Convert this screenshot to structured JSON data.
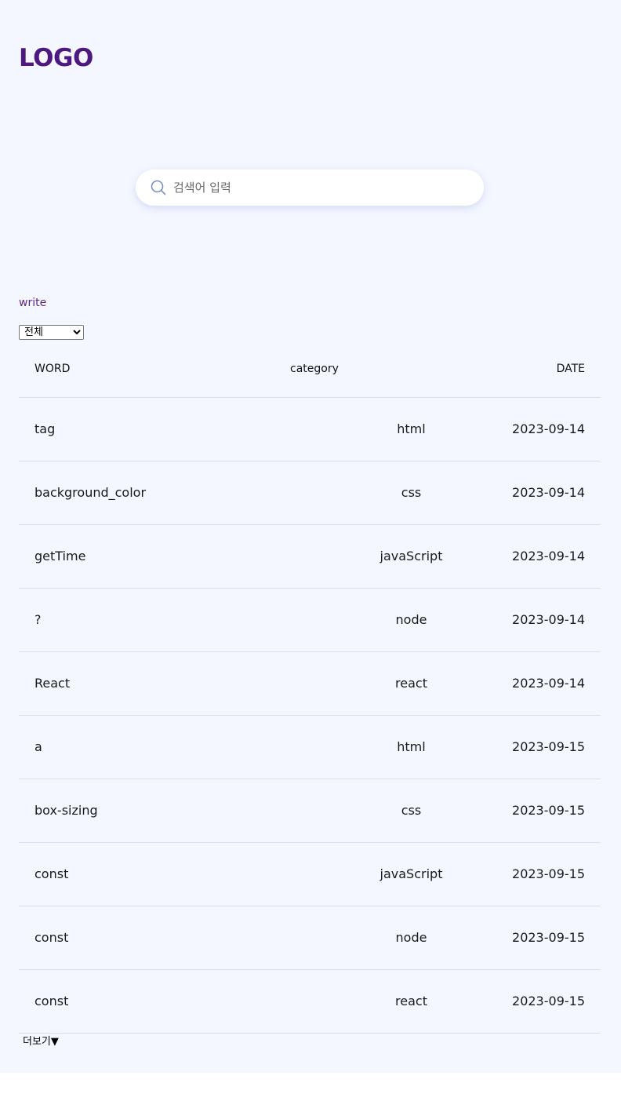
{
  "header": {
    "logo": "LOGO"
  },
  "search": {
    "placeholder": "검색어 입력",
    "value": ""
  },
  "toolbar": {
    "write_label": "write",
    "category_select": {
      "selected": "전체"
    }
  },
  "table": {
    "columns": [
      "WORD",
      "category",
      "DATE"
    ],
    "rows": [
      {
        "word": "tag",
        "category": "html",
        "date": "2023-09-14"
      },
      {
        "word": "background_color",
        "category": "css",
        "date": "2023-09-14"
      },
      {
        "word": "getTime",
        "category": "javaScript",
        "date": "2023-09-14"
      },
      {
        "word": "?",
        "category": "node",
        "date": "2023-09-14"
      },
      {
        "word": "React",
        "category": "react",
        "date": "2023-09-14"
      },
      {
        "word": "a",
        "category": "html",
        "date": "2023-09-15"
      },
      {
        "word": "box-sizing",
        "category": "css",
        "date": "2023-09-15"
      },
      {
        "word": "const",
        "category": "javaScript",
        "date": "2023-09-15"
      },
      {
        "word": "const",
        "category": "node",
        "date": "2023-09-15"
      },
      {
        "word": "const",
        "category": "react",
        "date": "2023-09-15"
      }
    ]
  },
  "footer": {
    "more_label": "더보기▼"
  },
  "colors": {
    "logo": "#4d1880",
    "page_background": "#f4f7ff",
    "search_icon": "#7a8fc4",
    "row_divider": "#dcdee6"
  },
  "icons": {
    "search": "search-icon"
  }
}
